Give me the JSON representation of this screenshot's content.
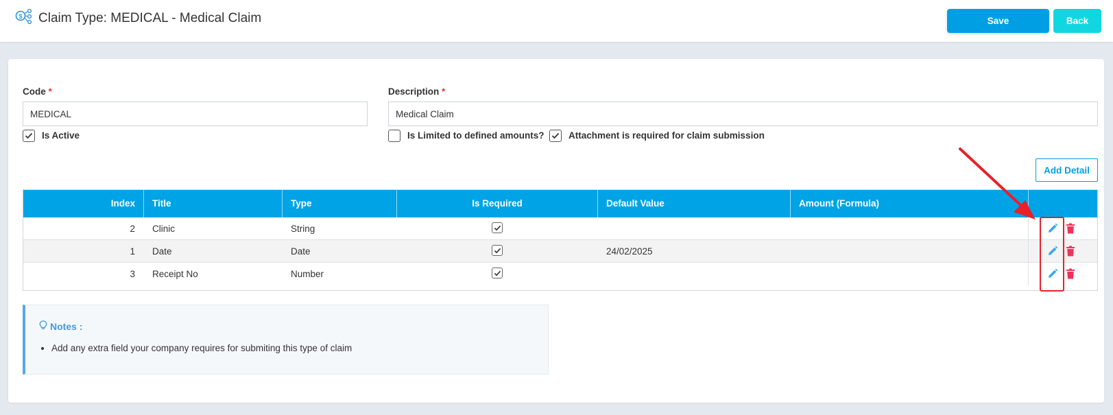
{
  "header": {
    "title": "Claim Type: MEDICAL - Medical Claim",
    "save_label": "Save",
    "back_label": "Back"
  },
  "form": {
    "code_label": "Code",
    "code_value": "MEDICAL",
    "description_label": "Description",
    "description_value": "Medical Claim",
    "required_marker": "*",
    "is_active_label": "Is Active",
    "is_active_checked": true,
    "limited_label": "Is Limited to defined amounts?",
    "limited_checked": false,
    "attachment_label": "Attachment is required for claim submission",
    "attachment_checked": true
  },
  "details": {
    "add_label": "Add Detail",
    "columns": [
      "Index",
      "Title",
      "Type",
      "Is Required",
      "Default Value",
      "Amount (Formula)"
    ],
    "rows": [
      {
        "index": "2",
        "title": "Clinic",
        "type": "String",
        "required": true,
        "default": "",
        "formula": ""
      },
      {
        "index": "1",
        "title": "Date",
        "type": "Date",
        "required": true,
        "default": "24/02/2025",
        "formula": ""
      },
      {
        "index": "3",
        "title": "Receipt No",
        "type": "Number",
        "required": true,
        "default": "",
        "formula": ""
      }
    ]
  },
  "notes": {
    "title": "Notes :",
    "items": [
      "Add any extra field your company requires for submiting this type of claim"
    ]
  },
  "colors": {
    "primary": "#009fe3",
    "secondary": "#11d6e0",
    "header_bg": "#00a3e6",
    "delete": "#f0325a",
    "highlight": "#e8202a"
  }
}
